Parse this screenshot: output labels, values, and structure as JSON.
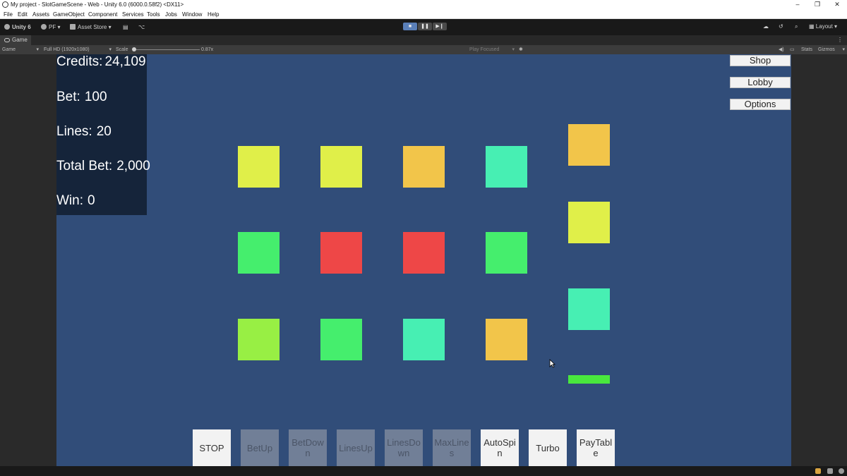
{
  "window": {
    "title": "My project - SlotGameScene - Web - Unity 6.0 (6000.0.58f2) <DX11>",
    "controls": [
      "–",
      "❐",
      "✕"
    ]
  },
  "menu": [
    "File",
    "Edit",
    "Assets",
    "GameObject",
    "Component",
    "Services",
    "Tools",
    "Jobs",
    "Window",
    "Help"
  ],
  "toolbar": {
    "account": "Unity 6",
    "pf": "PF",
    "asset_store": "Asset Store",
    "layout": "Layout",
    "play_buttons": [
      "■",
      "❚❚",
      "▶❙"
    ]
  },
  "tabs": {
    "game": "Game",
    "menu": "⋮"
  },
  "gamebar": {
    "display": "Game",
    "resolution": "Full HD (1920x1080)",
    "scale_label": "Scale",
    "scale_value": "0.87x",
    "play_mode": "Play Focused",
    "stats": "Stats",
    "gizmos": "Gizmos"
  },
  "slot": {
    "credits_label": "Credits:",
    "credits_value": "24,109",
    "bet_label": "Bet:",
    "bet_value": "100",
    "lines_label": "Lines:",
    "lines_value": "20",
    "total_bet_label": "Total Bet:",
    "total_bet_value": "2,000",
    "win_label": "Win:",
    "win_value": "0"
  },
  "side_buttons": [
    "Shop",
    "Lobby",
    "Options"
  ],
  "bottom_buttons": [
    {
      "label": "STOP",
      "enabled": true
    },
    {
      "label": "BetUp",
      "enabled": false
    },
    {
      "label": "BetDown",
      "enabled": false
    },
    {
      "label": "LinesUp",
      "enabled": false
    },
    {
      "label": "LinesDown",
      "enabled": false
    },
    {
      "label": "MaxLines",
      "enabled": false
    },
    {
      "label": "AutoSpin",
      "enabled": true
    },
    {
      "label": "Turbo",
      "enabled": true
    },
    {
      "label": "PayTable",
      "enabled": true
    }
  ],
  "reels": {
    "grid_rows": [
      [
        "#e0ef49",
        "#e0ef49",
        "#f2c54a",
        "#47efb3"
      ],
      [
        "#45ee6d",
        "#ee4747",
        "#ee4747",
        "#45ee6d"
      ],
      [
        "#98ef44",
        "#45ee6d",
        "#47efb3",
        "#f2c54a"
      ]
    ],
    "fifth_reel": [
      "#f2c54a",
      "#e0ef49",
      "#47efb3",
      "#49e73d"
    ]
  }
}
